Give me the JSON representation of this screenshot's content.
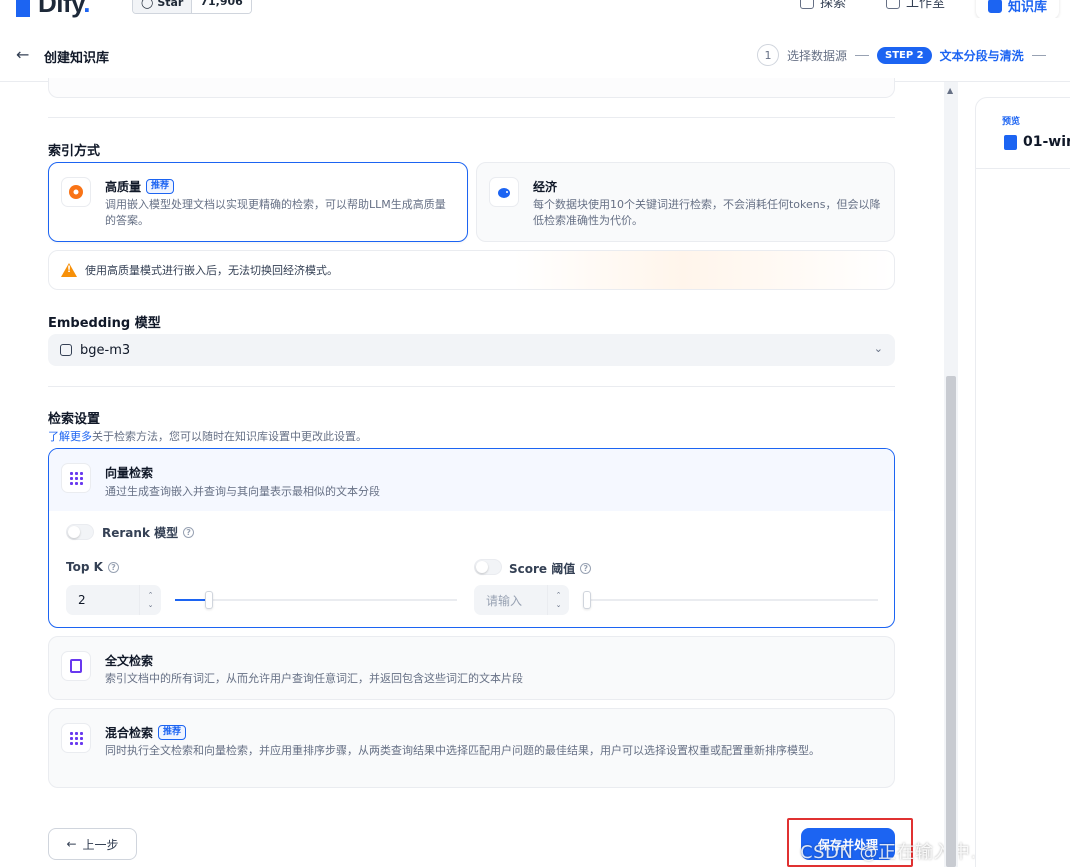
{
  "topnav": {
    "logo_text": "Dify",
    "star_label": "Star",
    "star_count": "71,906",
    "links": [
      {
        "label": "探索"
      },
      {
        "label": "工作室"
      },
      {
        "label": "知识库"
      }
    ]
  },
  "header": {
    "title": "创建知识库",
    "steps": [
      {
        "num": "1",
        "label": "选择数据源"
      },
      {
        "badge": "STEP 2",
        "label": "文本分段与清洗"
      }
    ]
  },
  "index_method": {
    "title": "索引方式",
    "options": [
      {
        "title": "高质量",
        "tag": "推荐",
        "desc": "调用嵌入模型处理文档以实现更精确的检索，可以帮助LLM生成高质量的答案。",
        "selected": true
      },
      {
        "title": "经济",
        "desc": "每个数据块使用10个关键词进行检索，不会消耗任何tokens，但会以降低检索准确性为代价。",
        "selected": false
      }
    ],
    "warning": "使用高质量模式进行嵌入后，无法切换回经济模式。"
  },
  "embedding": {
    "title": "Embedding 模型",
    "model": "bge-m3"
  },
  "retrieval": {
    "title": "检索设置",
    "learn_more_link": "了解更多",
    "learn_more_text": "关于检索方法，您可以随时在知识库设置中更改此设置。",
    "vector": {
      "title": "向量检索",
      "desc": "通过生成查询嵌入并查询与其向量表示最相似的文本分段",
      "rerank_label": "Rerank 模型",
      "topk_label": "Top K",
      "topk_value": "2",
      "topk_slider_fraction": 0.12,
      "score_label": "Score 阈值",
      "score_placeholder": "请输入"
    },
    "fulltext": {
      "title": "全文检索",
      "desc": "索引文档中的所有词汇，从而允许用户查询任意词汇，并返回包含这些词汇的文本片段"
    },
    "hybrid": {
      "title": "混合检索",
      "tag": "推荐",
      "desc": "同时执行全文检索和向量检索，并应用重排序步骤，从两类查询结果中选择匹配用户问题的最佳结果，用户可以选择设置权重或配置重新排序模型。"
    }
  },
  "footer": {
    "prev_label": "上一步",
    "save_label": "保存并处理"
  },
  "preview": {
    "label": "预览",
    "file_name": "01-wir"
  },
  "watermark": "CSDN @正在输入中……",
  "colors": {
    "accent": "#1c64f2",
    "warning": "#f79009",
    "highlight": "#e03131"
  }
}
